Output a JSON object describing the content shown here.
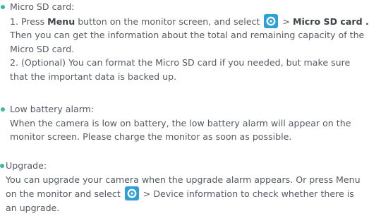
{
  "microsd": {
    "heading": "Micro SD card:",
    "line1_a": "1. Press ",
    "line1_menu": "Menu",
    "line1_b": " button on the monitor screen, and select ",
    "line1_c": " > ",
    "line1_target": "Micro SD card .",
    "line2": "Then you can get the information about the total and remaining capacity of the",
    "line3": "Micro SD card.",
    "line4": "2. (Optional) You can format the Micro SD card if you needed, but make sure",
    "line5": "that the important data is backed up."
  },
  "battery": {
    "heading": "Low battery alarm:",
    "line1": "When the camera is low on battery, the low battery alarm will appear on the",
    "line2": "monitor screen. Please charge the monitor as soon as possible."
  },
  "upgrade": {
    "heading": "Upgrade:",
    "line1": "You can upgrade your camera when the upgrade alarm appears. Or press Menu",
    "line2_a": "on the monitor and select ",
    "line2_b": " > Device information to check whether there is",
    "line3": "an upgrade."
  },
  "colors": {
    "bullet": "#3cb7a2",
    "settings_icon_bg": "#2f9fd8",
    "text": "#555a60"
  },
  "icons": {
    "settings": "settings-gear-icon"
  }
}
